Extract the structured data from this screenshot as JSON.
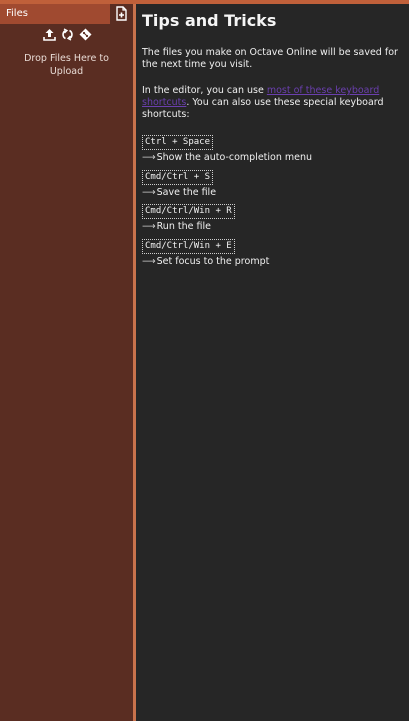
{
  "sidebar": {
    "header_label": "Files",
    "drop_text": "Drop Files Here to Upload",
    "icons": [
      "new-file-icon",
      "upload-icon",
      "refresh-icon",
      "git-icon"
    ]
  },
  "main": {
    "title": "Tips and Tricks",
    "intro": "The files you make on Octave Online will be saved for the next time you visit.",
    "editor_prefix": "In the editor, you can use ",
    "editor_link": "most of these keyboard shortcuts",
    "editor_suffix": ". You can also use these special keyboard shortcuts:",
    "shortcuts": [
      {
        "keys": "Ctrl + Space",
        "arrow": "⟶",
        "desc": "Show the auto-completion menu"
      },
      {
        "keys": "Cmd/Ctrl + S",
        "arrow": "⟶",
        "desc": "Save the file"
      },
      {
        "keys": "Cmd/Ctrl/Win + R",
        "arrow": "⟶",
        "desc": "Run the file"
      },
      {
        "keys": "Cmd/Ctrl/Win + E",
        "arrow": "⟶",
        "desc": "Set focus to the prompt"
      }
    ]
  },
  "colors": {
    "sidebar_bg": "#5a2d22",
    "sidebar_header_bg": "#a04a30",
    "accent": "#c8724c",
    "main_bg": "#262626",
    "link": "#6a3fae"
  }
}
